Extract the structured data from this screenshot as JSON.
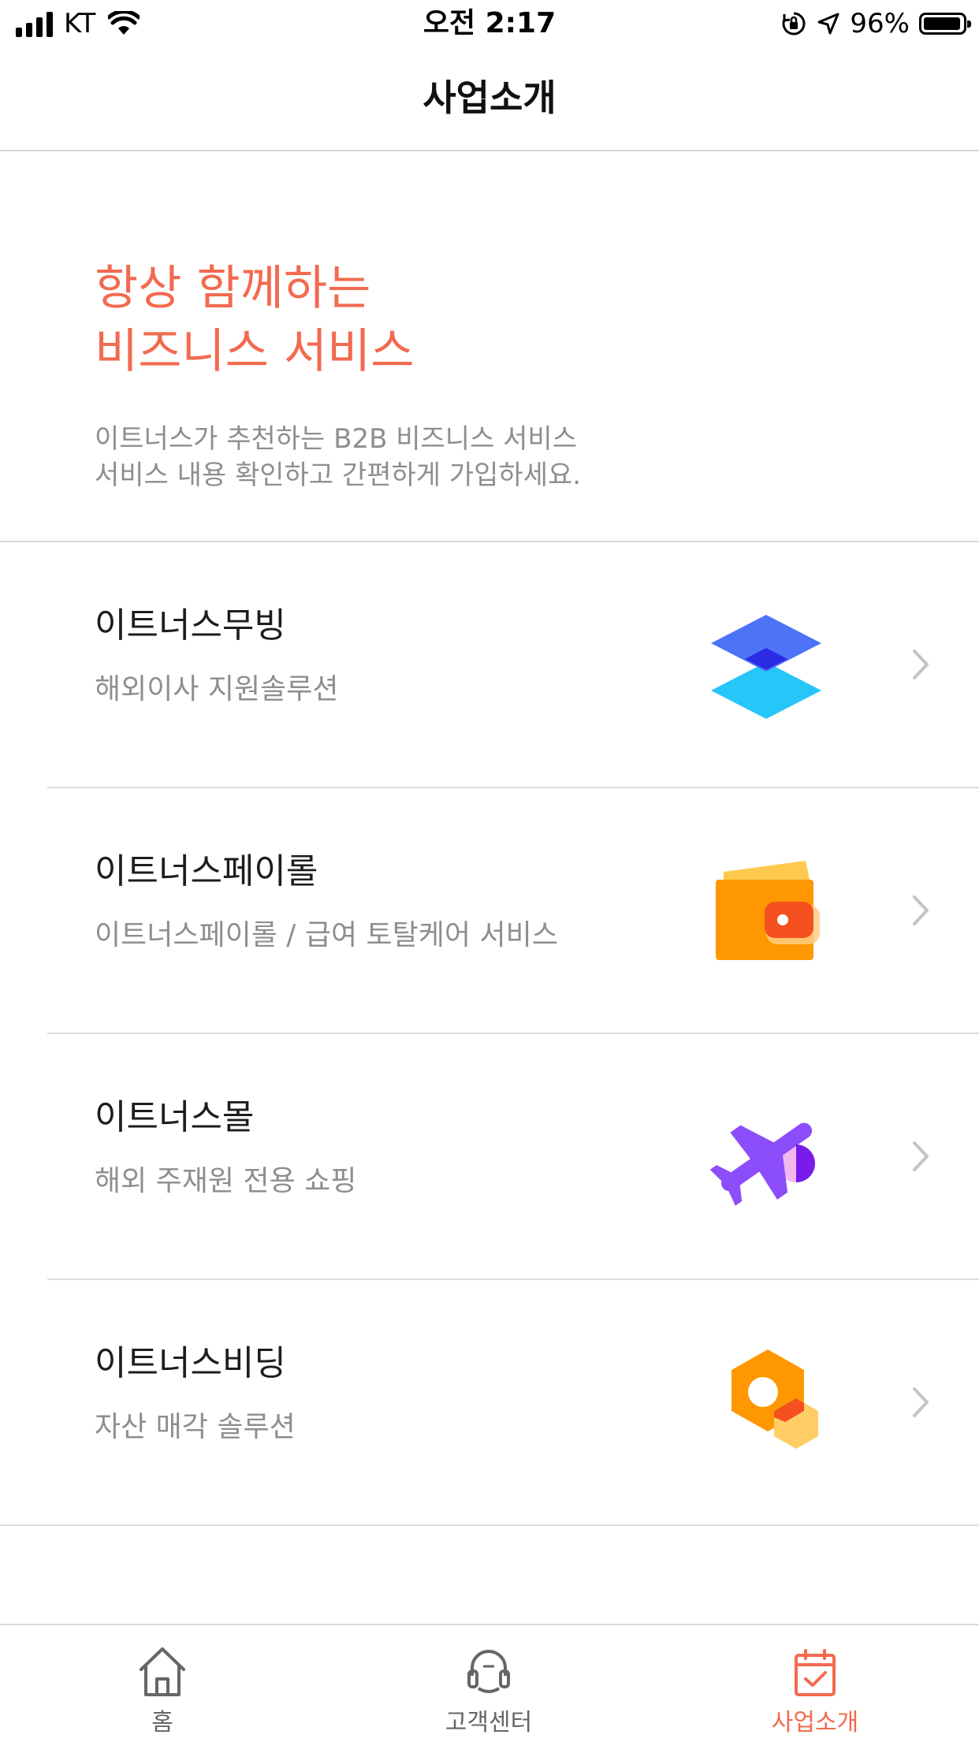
{
  "status_bar": {
    "carrier": "KT",
    "time": "오전 2:17",
    "battery_percent": "96%",
    "battery_level": 0.96
  },
  "nav": {
    "title": "사업소개"
  },
  "hero": {
    "title_line1": "항상 함께하는",
    "title_line2": "비즈니스 서비스",
    "subtitle_line1": "이트너스가 추천하는 B2B 비즈니스 서비스",
    "subtitle_line2": "서비스 내용 확인하고 간편하게 가입하세요.",
    "accent_color": "#f26a4f"
  },
  "services": [
    {
      "name": "이트너스무빙",
      "desc": "해외이사 지원솔루션",
      "icon": "layers-icon"
    },
    {
      "name": "이트너스페이롤",
      "desc": "이트너스페이롤 / 급여 토탈케어 서비스",
      "icon": "wallet-icon"
    },
    {
      "name": "이트너스몰",
      "desc": "해외 주재원 전용 쇼핑",
      "icon": "airplane-icon"
    },
    {
      "name": "이트너스비딩",
      "desc": "자산 매각 솔루션",
      "icon": "hexagon-icon"
    }
  ],
  "tab_bar": {
    "tabs": [
      {
        "label": "홈",
        "icon": "home-icon",
        "active": false
      },
      {
        "label": "고객센터",
        "icon": "headset-icon",
        "active": false
      },
      {
        "label": "사업소개",
        "icon": "calendar-check-icon",
        "active": true
      }
    ],
    "active_color": "#f26a4f",
    "inactive_color": "#666666"
  }
}
